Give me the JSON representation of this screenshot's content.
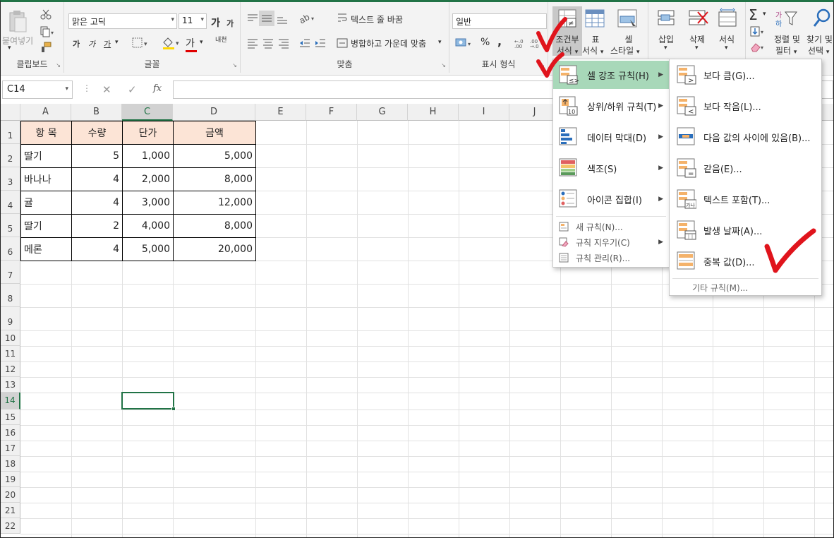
{
  "ribbon": {
    "clipboard": {
      "paste": "붙여넣기",
      "label": "클립보드"
    },
    "font": {
      "name": "맑은 고딕",
      "size": "11",
      "grow": "가",
      "shrink": "가",
      "bold": "가",
      "italic": "가",
      "underline": "가",
      "font_color_glyph": "가",
      "phonetic": "내천",
      "label": "글꼴"
    },
    "alignment": {
      "wrap": "텍스트 줄 바꿈",
      "merge": "병합하고 가운데 맞춤",
      "label": "맞춤"
    },
    "number": {
      "format": "일반",
      "percent": "%",
      "comma": ",",
      "label": "표시 형식"
    },
    "styles": {
      "conditional_1": "조건부",
      "conditional_2": "서식",
      "table_1": "표",
      "table_2": "서식",
      "cell_1": "셀",
      "cell_2": "스타일"
    },
    "cells": {
      "insert": "삽입",
      "delete": "삭제",
      "format": "서식"
    },
    "editing": {
      "sort_1": "정렬 및",
      "sort_2": "필터",
      "find_1": "찾기 및",
      "find_2": "선택"
    }
  },
  "formula_bar": {
    "name_box": "C14",
    "cancel": "✕",
    "enter": "✓",
    "fx": "fx"
  },
  "columns": [
    "A",
    "B",
    "C",
    "D",
    "E",
    "F",
    "G",
    "H",
    "I",
    "J"
  ],
  "rows": [
    "1",
    "2",
    "3",
    "4",
    "5",
    "6",
    "7",
    "8",
    "9",
    "10",
    "11",
    "12",
    "13",
    "14",
    "15",
    "16",
    "17",
    "18",
    "19",
    "20",
    "21",
    "22"
  ],
  "table": {
    "headers": [
      "항 목",
      "수량",
      "단가",
      "금액"
    ],
    "rows": [
      [
        "딸기",
        "5",
        "1,000",
        "5,000"
      ],
      [
        "바나나",
        "4",
        "2,000",
        "8,000"
      ],
      [
        "귤",
        "4",
        "3,000",
        "12,000"
      ],
      [
        "딸기",
        "2",
        "4,000",
        "8,000"
      ],
      [
        "메론",
        "4",
        "5,000",
        "20,000"
      ]
    ]
  },
  "cf_menu": {
    "items": [
      "셀 강조 규칙(H)",
      "상위/하위 규칙(T)",
      "데이터 막대(D)",
      "색조(S)",
      "아이콘 집합(I)"
    ],
    "small_items": [
      "새 규칙(N)...",
      "규칙 지우기(C)",
      "규칙 관리(R)..."
    ]
  },
  "highlight_menu": {
    "items": [
      "보다 큼(G)...",
      "보다 작음(L)...",
      "다음 값의 사이에 있음(B)...",
      "같음(E)...",
      "텍스트 포함(T)...",
      "발생 날짜(A)...",
      "중복 값(D)..."
    ],
    "more": "기타 규칙(M)..."
  },
  "colors": {
    "accent": "#217346",
    "header_fill": "#fce4d6",
    "menu_highlight": "#a8d8b9",
    "annotation": "#e0141c"
  }
}
